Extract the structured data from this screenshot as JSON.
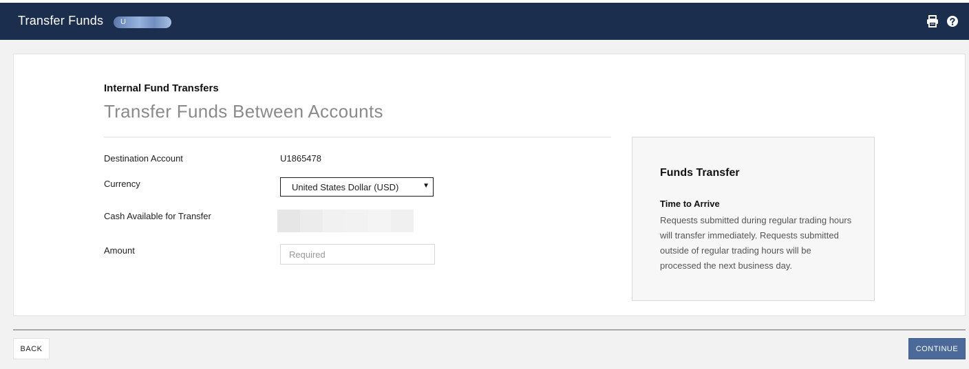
{
  "header": {
    "title": "Transfer Funds",
    "account_pill_text": "U",
    "print_icon": "printer-icon",
    "help_icon": "question-circle-icon"
  },
  "form": {
    "eyebrow": "Internal Fund Transfers",
    "heading": "Transfer Funds Between Accounts",
    "destination_label": "Destination Account",
    "destination_value": "U1865478",
    "currency_label": "Currency",
    "currency_value": "United States Dollar (USD)",
    "cash_label": "Cash Available for Transfer",
    "amount_label": "Amount",
    "amount_placeholder": "Required",
    "amount_value": ""
  },
  "info": {
    "title": "Funds Transfer",
    "subtitle": "Time to Arrive",
    "body": "Requests submitted during regular trading hours will transfer immediately. Requests submitted outside of regular trading hours will be processed the next business day."
  },
  "footer": {
    "back_label": "BACK",
    "continue_label": "CONTINUE"
  },
  "colors": {
    "header_bg": "#1c2e4e",
    "primary_button": "#4c6a99",
    "page_bg": "#f2f2f2"
  }
}
